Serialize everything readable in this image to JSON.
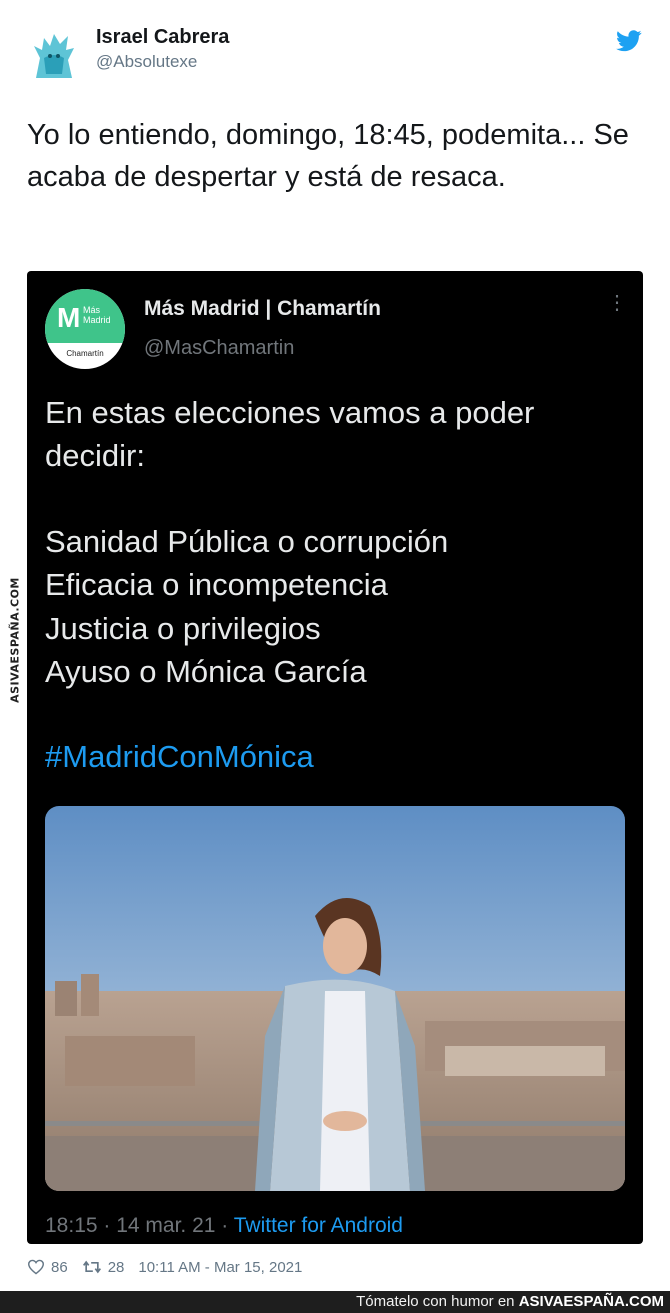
{
  "watermark": {
    "text": "ASIVAESPAÑA.COM"
  },
  "tweet": {
    "author_name": "Israel Cabrera",
    "author_handle": "@Absolutexe",
    "text": "Yo lo entiendo, domingo, 18:45, podemita... Se acaba de despertar y está de resaca.",
    "likes": "86",
    "retweets": "28",
    "timestamp": "10:11 AM - Mar 15, 2021",
    "icons": [
      "avatar-gargoyle-icon",
      "twitter-bird-icon",
      "heart-icon",
      "retweet-icon"
    ]
  },
  "embedded": {
    "avatar_logo_m": "M",
    "avatar_logo_text": "Más Madrid",
    "avatar_sub": "Chamartín",
    "name": "Más Madrid | Chamartín",
    "handle": "@MasChamartin",
    "menu": "⋮",
    "lines": [
      "En estas elecciones vamos a poder",
      "decidir:",
      "Sanidad Pública o corrupción",
      "Eficacia o incompetencia",
      "Justicia o privilegios",
      "Ayuso o Mónica García"
    ],
    "hashtag": "#MadridConMónica",
    "time": "18:15 · 14 mar. 21 · ",
    "source": "Twitter for Android"
  },
  "footer": {
    "tagline": "Tómatelo con humor en ",
    "brand": "ASIVAESPAÑA.COM"
  },
  "colors": {
    "accent": "#1d9bf0",
    "logo_green": "#3fc48a",
    "embed_bg": "#000000"
  }
}
